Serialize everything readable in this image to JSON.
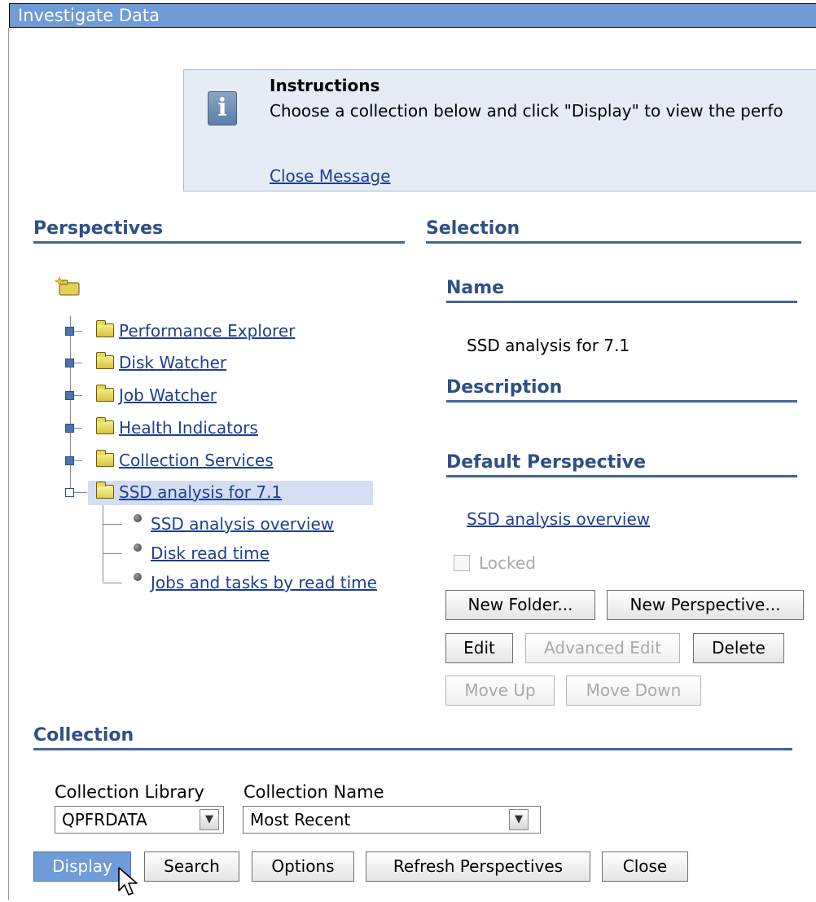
{
  "window": {
    "title": "Investigate Data"
  },
  "instructions": {
    "title": "Instructions",
    "text": "Choose a collection below and click \"Display\" to view the perfo",
    "close_label": "Close Message",
    "icon": "info-icon"
  },
  "perspectives": {
    "heading": "Perspectives",
    "root_icon": "new-folder-icon",
    "folders": [
      {
        "label": "Performance Explorer"
      },
      {
        "label": "Disk Watcher"
      },
      {
        "label": "Job Watcher"
      },
      {
        "label": "Health Indicators"
      },
      {
        "label": "Collection Services"
      },
      {
        "label": "SSD analysis for 7.1"
      }
    ],
    "children": [
      {
        "label": "SSD analysis overview"
      },
      {
        "label": "Disk read time"
      },
      {
        "label": "Jobs and tasks by read time"
      }
    ]
  },
  "selection": {
    "heading": "Selection",
    "name_heading": "Name",
    "name_value": "SSD analysis for 7.1",
    "description_heading": "Description",
    "default_perspective_heading": "Default Perspective",
    "default_perspective_value": "SSD analysis overview",
    "locked_label": "Locked",
    "buttons": {
      "new_folder": "New Folder...",
      "new_perspective": "New Perspective...",
      "edit": "Edit",
      "advanced_edit": "Advanced Edit",
      "delete": "Delete",
      "move_up": "Move Up",
      "move_down": "Move Down"
    }
  },
  "collection": {
    "heading": "Collection",
    "library_label": "Collection Library",
    "library_value": "QPFRDATA",
    "name_label": "Collection Name",
    "name_value": "Most Recent"
  },
  "actions": {
    "display": "Display",
    "search": "Search",
    "options": "Options",
    "refresh": "Refresh Perspectives",
    "close": "Close"
  },
  "colors": {
    "accent": "#6f9bd8",
    "heading": "#2f4f86",
    "link": "#1f3f8f",
    "message_bg": "#e5ecf6"
  }
}
